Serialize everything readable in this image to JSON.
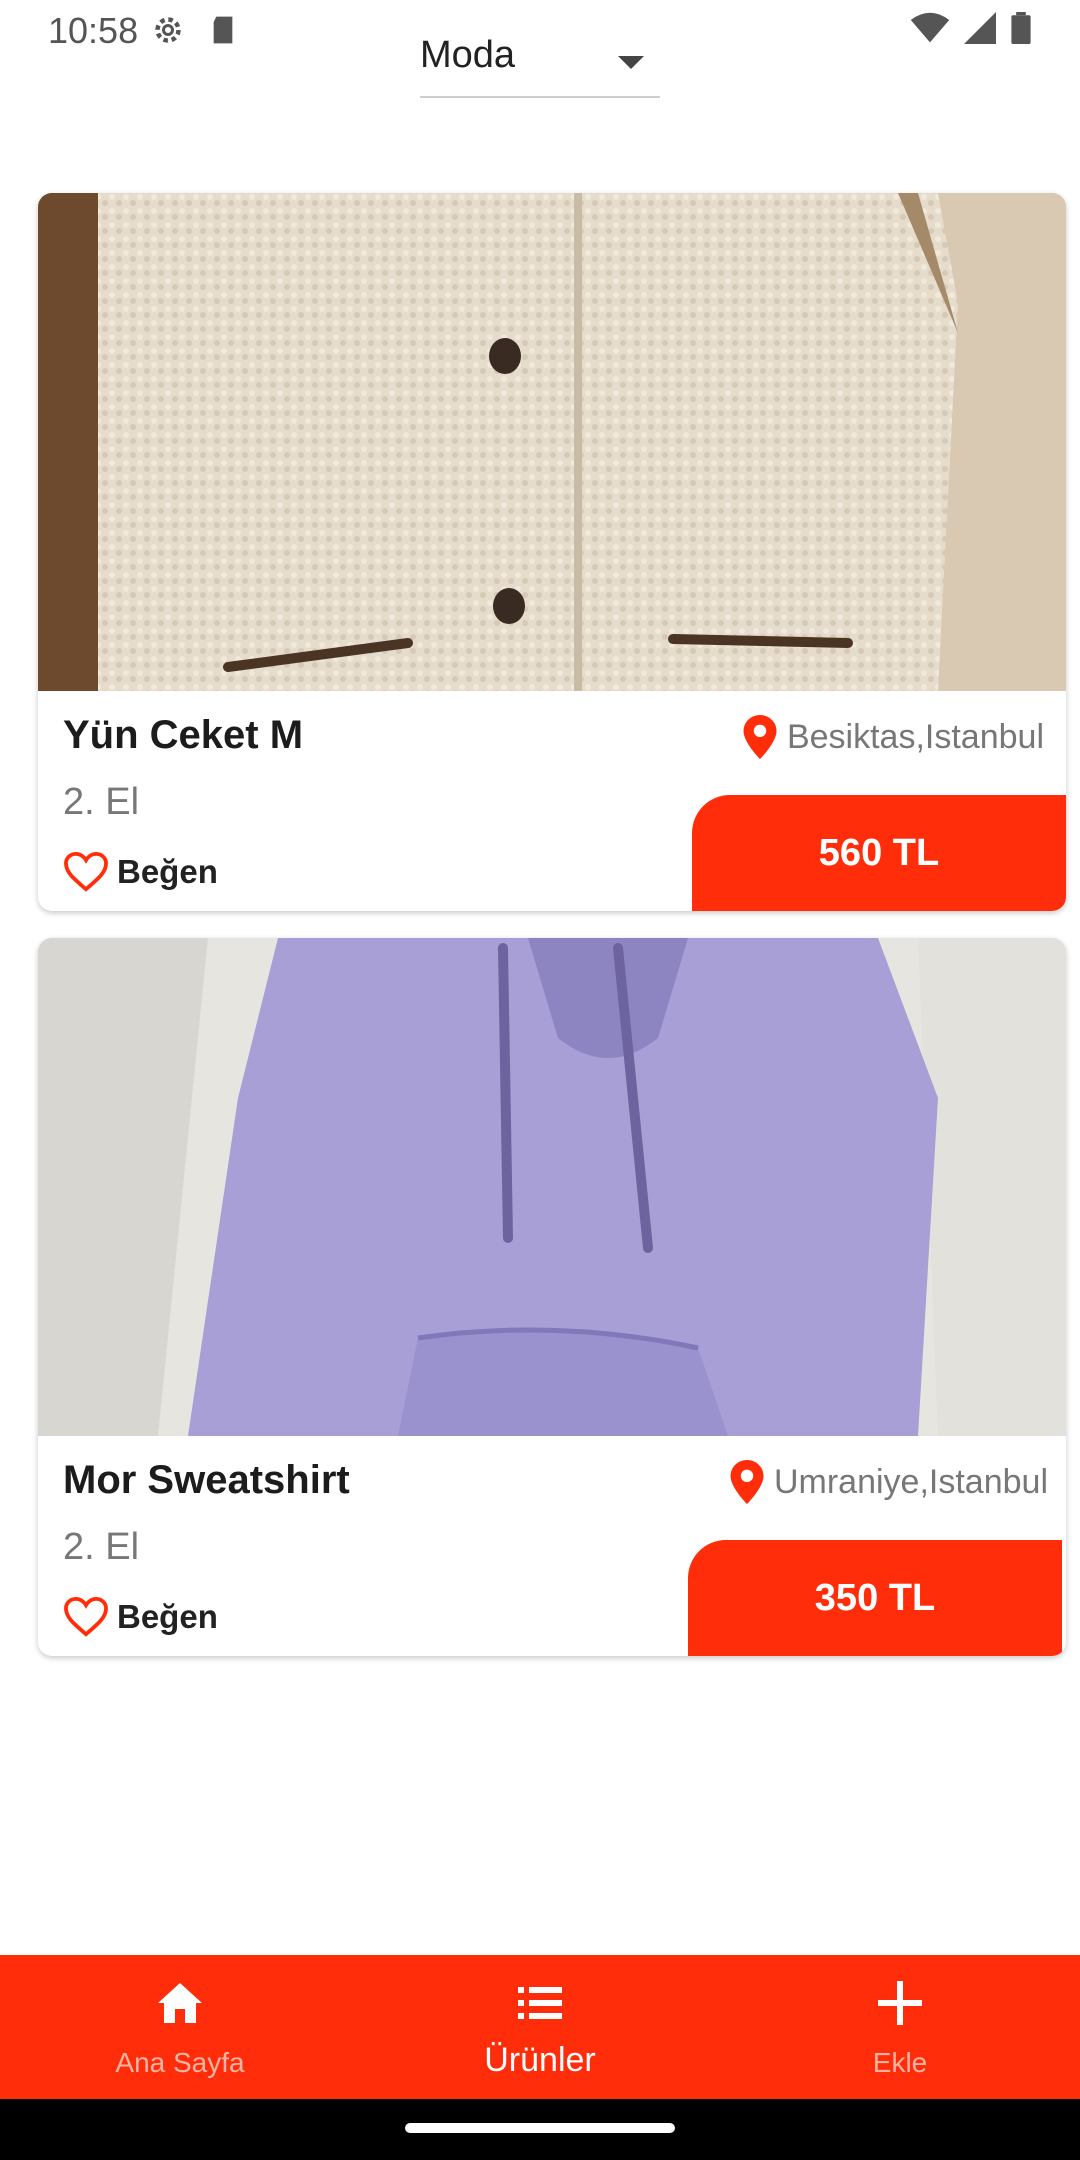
{
  "status_bar": {
    "time": "10:58"
  },
  "category": {
    "selected": "Moda"
  },
  "products": [
    {
      "title": "Yün Ceket M",
      "condition": "2. El",
      "like_label": "Beğen",
      "location": "Besiktas,Istanbul",
      "price": "560 TL"
    },
    {
      "title": "Mor Sweatshirt",
      "condition": "2. El",
      "like_label": "Beğen",
      "location": "Umraniye,Istanbul",
      "price": "350 TL"
    }
  ],
  "bottom_nav": {
    "home": "Ana Sayfa",
    "products": "Ürünler",
    "add": "Ekle"
  },
  "colors": {
    "accent": "#ff2d0a",
    "inactive_nav": "#ffb3a3"
  }
}
